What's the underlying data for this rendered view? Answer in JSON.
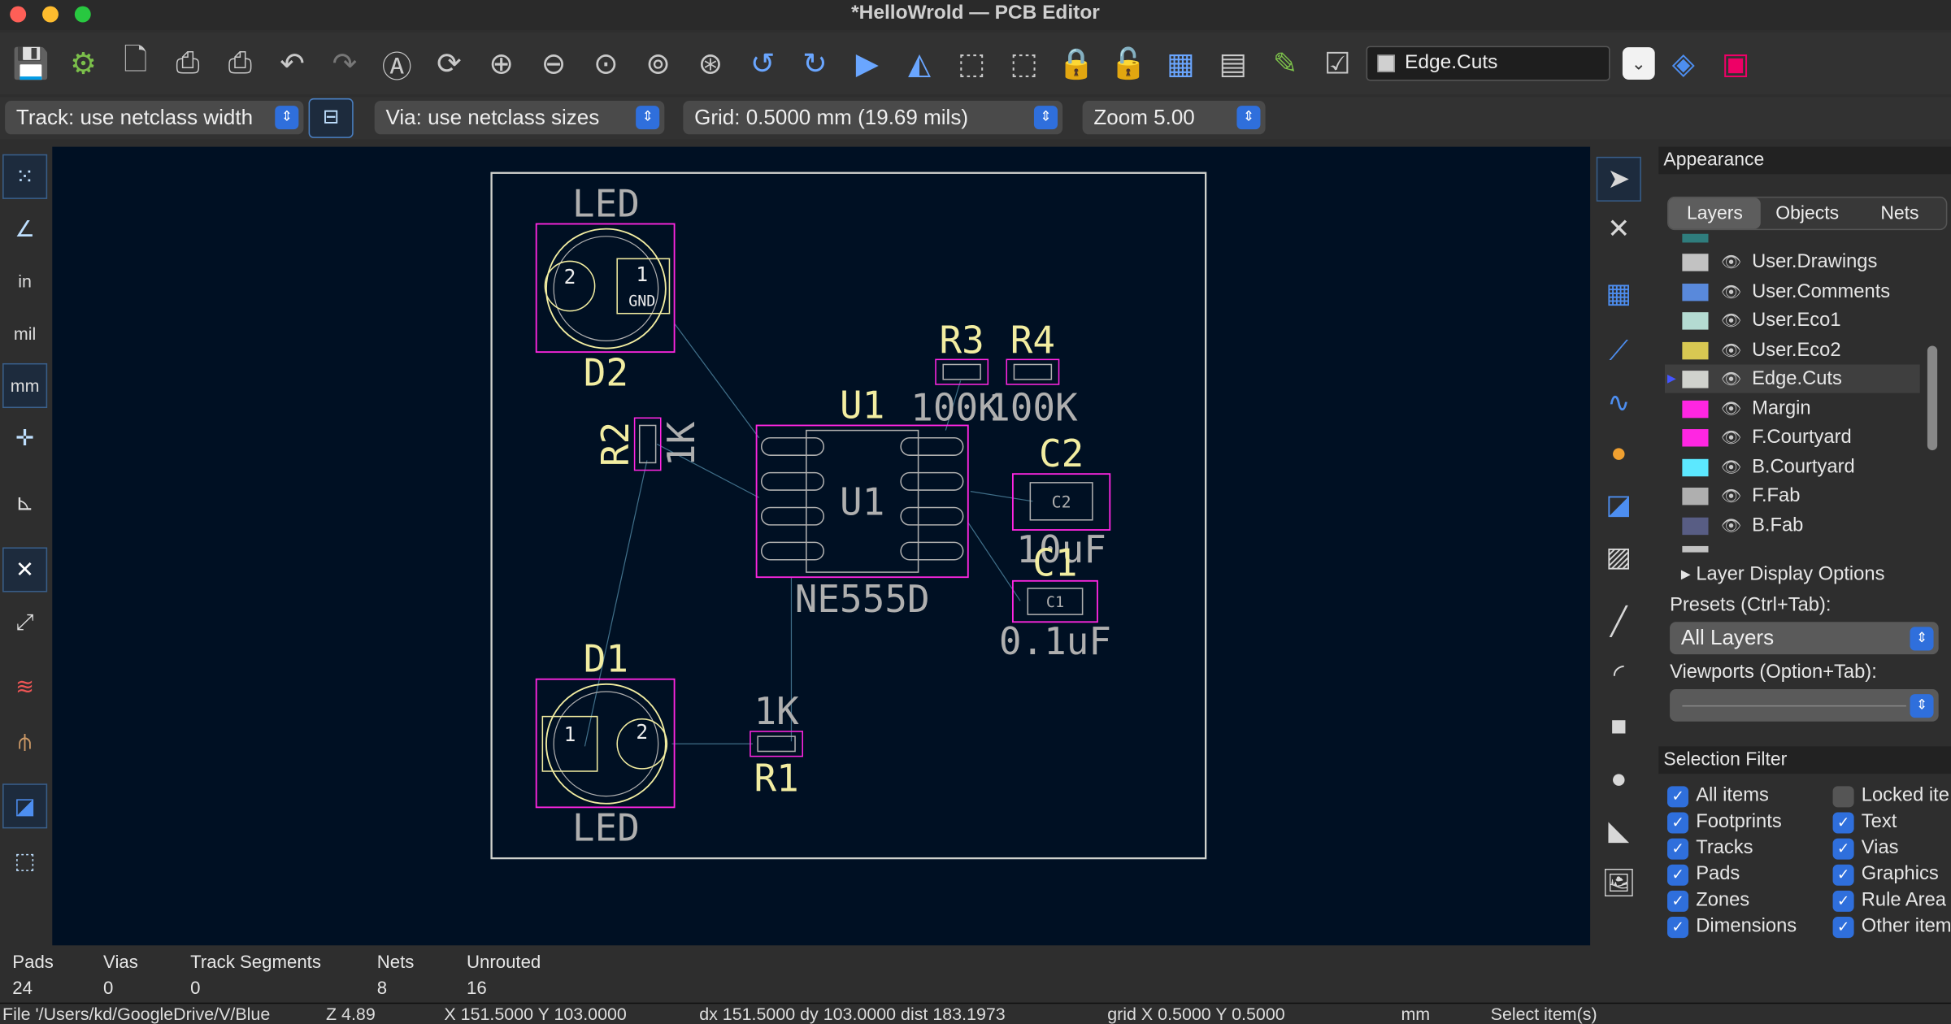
{
  "window": {
    "title": "*HelloWrold — PCB Editor"
  },
  "toolbar": {
    "icons": [
      "save-icon",
      "board-setup-icon",
      "page-settings-icon",
      "print-icon",
      "plot-icon",
      "undo-icon",
      "redo-icon",
      "find-icon",
      "refresh-icon",
      "zoom-in-icon",
      "zoom-out-icon",
      "zoom-fit-icon",
      "zoom-objects-icon",
      "zoom-selection-icon",
      "rotate-ccw-icon",
      "rotate-cw-icon",
      "flip-icon",
      "mirror-icon",
      "group-icon",
      "ungroup-icon",
      "lock-icon",
      "unlock-icon",
      "drc-icon",
      "footprint-browser-icon",
      "scripting-icon",
      "checklist-icon"
    ],
    "active_layer": "Edge.Cuts",
    "layer_color": "#d0d0d0"
  },
  "toolbar2": {
    "track": "Track: use netclass width",
    "via": "Via: use netclass sizes",
    "grid": "Grid: 0.5000 mm (19.69 mils)",
    "zoom": "Zoom 5.00"
  },
  "left_tools": [
    "grid-icon",
    "polar-icon",
    "inches-icon",
    "mils-icon",
    "mm-icon",
    "cursor-icon",
    "axes-icon",
    "ratsnest-icon",
    "curved-ratsnest-icon",
    "track-outline-icon",
    "via-icon",
    "zone-icon",
    "bbox-icon"
  ],
  "left_labels": {
    "inches": "in",
    "mils": "mil",
    "mm": "mm"
  },
  "right_tools": [
    "select-icon",
    "local-ratsnest-icon",
    "footprint-icon",
    "route-track-icon",
    "tune-length-icon",
    "via-icon",
    "zone-icon",
    "rule-area-icon",
    "line-icon",
    "arc-icon",
    "rectangle-icon",
    "circle-icon",
    "polygon-icon",
    "image-icon"
  ],
  "pcb": {
    "D2": {
      "value": "LED",
      "ref": "D2",
      "pad1": "1",
      "pad2": "2",
      "net": "GND"
    },
    "D1": {
      "value": "LED",
      "ref": "D1",
      "pad1": "1",
      "pad2": "2"
    },
    "R2": {
      "ref": "R2",
      "value": "1K"
    },
    "R1": {
      "ref": "R1",
      "value": "1K"
    },
    "R3": {
      "ref": "R3",
      "value": "100K"
    },
    "R4": {
      "ref": "R4",
      "value": "100K"
    },
    "U1": {
      "ref": "U1",
      "value": "NE555D",
      "fab": "U1"
    },
    "C2": {
      "ref": "C2",
      "value": "10uF",
      "fab": "C2"
    },
    "C1": {
      "ref": "C1",
      "value": "0.1uF",
      "fab": "C1"
    },
    "colors": {
      "background": "#001023",
      "courtyard": "#ff26e2",
      "silk": "#f2eda1",
      "fab": "#afafaf",
      "edge": "#d0d2cd",
      "ratsnest": "#3f6e88",
      "pad": "#c8454d"
    }
  },
  "appearance": {
    "title": "Appearance",
    "tabs": [
      "Layers",
      "Objects",
      "Nets"
    ],
    "active_tab": "Layers",
    "layers": [
      {
        "name": "User.Drawings",
        "color": "#c2c2c2"
      },
      {
        "name": "User.Comments",
        "color": "#5989db"
      },
      {
        "name": "User.Eco1",
        "color": "#b4dbd2"
      },
      {
        "name": "User.Eco2",
        "color": "#d8c852"
      },
      {
        "name": "Edge.Cuts",
        "color": "#d0d2cd",
        "active": true
      },
      {
        "name": "Margin",
        "color": "#ff26e2"
      },
      {
        "name": "F.Courtyard",
        "color": "#ff26e2"
      },
      {
        "name": "B.Courtyard",
        "color": "#5ce8ff"
      },
      {
        "name": "F.Fab",
        "color": "#afafaf"
      },
      {
        "name": "B.Fab",
        "color": "#585d84"
      }
    ],
    "layer_display_options": "Layer Display Options",
    "presets_label": "Presets (Ctrl+Tab):",
    "presets_value": "All Layers",
    "viewports_label": "Viewports (Option+Tab):"
  },
  "selection_filter": {
    "title": "Selection Filter",
    "items": [
      {
        "label": "All items",
        "checked": true
      },
      {
        "label": "Locked ite",
        "checked": false
      },
      {
        "label": "Footprints",
        "checked": true
      },
      {
        "label": "Text",
        "checked": true
      },
      {
        "label": "Tracks",
        "checked": true
      },
      {
        "label": "Vias",
        "checked": true
      },
      {
        "label": "Pads",
        "checked": true
      },
      {
        "label": "Graphics",
        "checked": true
      },
      {
        "label": "Zones",
        "checked": true
      },
      {
        "label": "Rule Area",
        "checked": true
      },
      {
        "label": "Dimensions",
        "checked": true
      },
      {
        "label": "Other item",
        "checked": true
      }
    ]
  },
  "stats": [
    {
      "label": "Pads",
      "value": "24"
    },
    {
      "label": "Vias",
      "value": "0"
    },
    {
      "label": "Track Segments",
      "value": "0"
    },
    {
      "label": "Nets",
      "value": "8"
    },
    {
      "label": "Unrouted",
      "value": "16"
    }
  ],
  "status": {
    "file": "File '/Users/kd/GoogleDrive/V/Blue",
    "zoom": "Z 4.89",
    "xy": "X 151.5000  Y 103.0000",
    "dxy": "dx 151.5000  dy 103.0000  dist 183.1973",
    "grid": "grid X 0.5000  Y 0.5000",
    "units": "mm",
    "action": "Select item(s)"
  }
}
